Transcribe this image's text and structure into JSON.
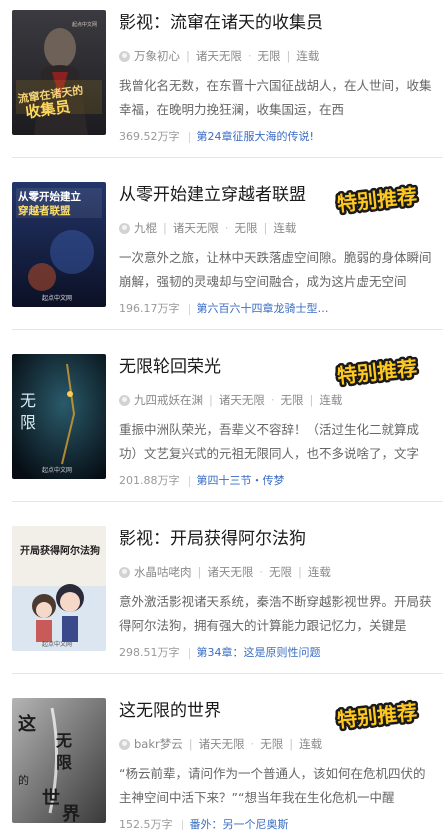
{
  "books": [
    {
      "title": "影视：流窜在诸天的收集员",
      "author": "万象初心",
      "category": "诸天无限",
      "subcategory": "无限",
      "status": "连载",
      "description": "我曾化名无数，在东晋十六国征战胡人，在人世间，收集幸福，在晚明力挽狂澜，收集国运，在西",
      "word_count": "369.52万字",
      "latest_chapter": "第24章征服大海的传说!",
      "recommended": false,
      "cover_text": "流窜在诸天的收集员",
      "cover_colors": [
        "#2a2a30",
        "#6a5a48"
      ]
    },
    {
      "title": "从零开始建立穿越者联盟",
      "author": "九棍",
      "category": "诸天无限",
      "subcategory": "无限",
      "status": "连载",
      "description": "一次意外之旅，让林中天跌落虚空间隙。脆弱的身体瞬间崩解，强韧的灵魂却与空间融合，成为这片虚无空间",
      "word_count": "196.17万字",
      "latest_chapter": "第六百六十四章龙骑士型…",
      "recommended": true,
      "cover_text": "从零开始建立穿越者联盟",
      "cover_colors": [
        "#1a2a5a",
        "#0d1530"
      ]
    },
    {
      "title": "无限轮回荣光",
      "author": "九四戒妖在渊",
      "category": "诸天无限",
      "subcategory": "无限",
      "status": "连载",
      "description": "重振中洲队荣光，吾辈义不容辞！（活过生化二就算成功）文艺复兴式的元祖无限同人，也不多说啥了，文字",
      "word_count": "201.88万字",
      "latest_chapter": "第四十三节・传梦",
      "recommended": true,
      "cover_text": "无限",
      "cover_colors": [
        "#0a1a2a",
        "#153040"
      ]
    },
    {
      "title": "影视：开局获得阿尔法狗",
      "author": "水晶咕咾肉",
      "category": "诸天无限",
      "subcategory": "无限",
      "status": "连载",
      "description": "意外激活影视诸天系统，秦浩不断穿越影视世界。开局获得阿尔法狗，拥有强大的计算能力跟记忆力，关键是",
      "word_count": "298.51万字",
      "latest_chapter": "第34章：这是原则性问题",
      "recommended": false,
      "cover_text": "开局获得阿尔法狗",
      "cover_colors": [
        "#f4f2ee",
        "#c8d8e8"
      ]
    },
    {
      "title": "这无限的世界",
      "author": "bakr梦云",
      "category": "诸天无限",
      "subcategory": "无限",
      "status": "连载",
      "description": "“杨云前辈，请问作为一个普通人，该如何在危机四伏的主神空间中活下来？”“想当年我在生化危机一中醒",
      "word_count": "152.5万字",
      "latest_chapter": "番外：另一个尼奥斯",
      "recommended": true,
      "cover_text": "这无限的世界",
      "cover_colors": [
        "#9a9a9a",
        "#3a3a3a"
      ]
    }
  ],
  "recommend_badge": "特别推荐",
  "publisher_mark": "起点中文网",
  "meta_separator": "·",
  "meta_pipe": "|"
}
